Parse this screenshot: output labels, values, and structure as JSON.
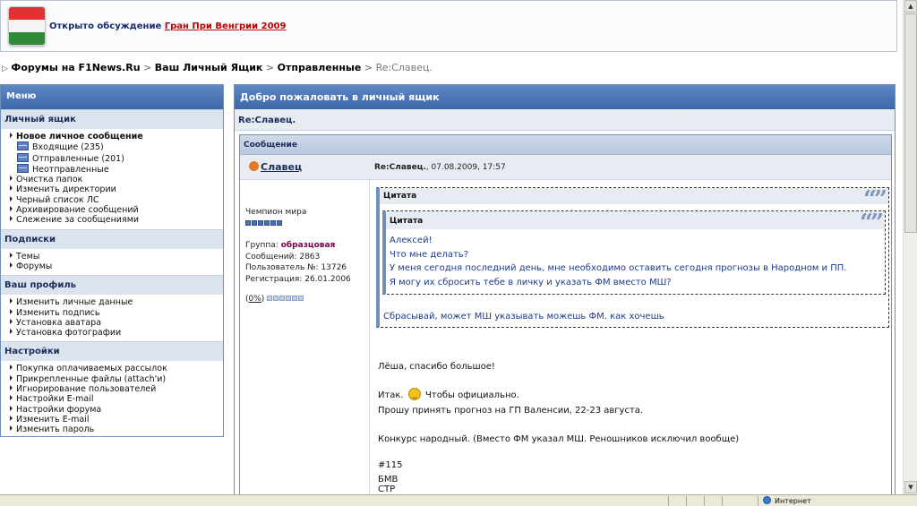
{
  "banner": {
    "text": "Открыто обсуждение",
    "link": "Гран При Венгрии 2009"
  },
  "breadcrumb": {
    "item1": "Форумы на F1News.Ru",
    "item2": "Ваш Личный Ящик",
    "item3": "Отправленные",
    "current": "Re:Славец."
  },
  "menu": {
    "title": "Меню",
    "sections": {
      "mailbox": {
        "title": "Личный ящик",
        "new_message": "Новое личное сообщение",
        "inbox": "Входящие (235)",
        "sent": "Отправленные (201)",
        "unsent": "Неотправленные",
        "clean": "Очистка папок",
        "dirs": "Изменить директории",
        "blacklist": "Черный список ЛС",
        "archive": "Архивирование сообщений",
        "tracking": "Слежение за сообщениями"
      },
      "subscriptions": {
        "title": "Подписки",
        "topics": "Темы",
        "forums": "Форумы"
      },
      "profile": {
        "title": "Ваш профиль",
        "personal": "Изменить личные данные",
        "signature": "Изменить подпись",
        "avatar": "Установка аватара",
        "photo": "Установка фотографии"
      },
      "settings": {
        "title": "Настройки",
        "paid": "Покупка оплачиваемых рассылок",
        "attach": "Прикрепленные файлы (attach'и)",
        "ignore": "Игнорирование пользователей",
        "email_settings": "Настройки E-mail",
        "forum_settings": "Настройки форума",
        "change_email": "Изменить E-mail",
        "change_password": "Изменить пароль"
      }
    }
  },
  "content": {
    "title": "Добро пожаловать в личный ящик",
    "subject": "Re:Славец.",
    "message_header": "Сообщение",
    "author": "Славец",
    "post_title": "Re:Славец.",
    "post_date": ", 07.08.2009, 17:57",
    "user": {
      "rank": "Чемпион мира",
      "rank_level": 6,
      "group_label": "Группа:",
      "group_value": "образцовая",
      "posts": "Сообщений: 2863",
      "user_no": "Пользователь №: 13726",
      "registered": "Регистрация: 26.01.2006",
      "progress": "0%"
    },
    "quote_label_outer": "Цитата",
    "quote_label_inner": "Цитата",
    "inner_quote_lines": [
      "Алексей!",
      "Что мне делать?",
      "У меня сегодня последний день, мне необходимо оставить сегодня прогнозы в Народном и ПП.",
      "Я могу их сбросить тебе в личку и указать ФМ вместо МШ?"
    ],
    "outer_quote_text": "Сбрасывай, может МШ указывать можешь ФМ. как хочешь",
    "post_lines": {
      "l1": "Лёша, спасибо большое!",
      "l2a": "Итак.",
      "l2b": "Чтобы официально.",
      "l3": "Прошу принять прогноз на ГП Валенсии, 22-23 августа.",
      "l4": "Конкурс народный. (Вместо ФМ указал МШ. Реношников исключил вообще)",
      "l5": "#115",
      "l6": "БМВ",
      "l7": "СТР"
    }
  },
  "statusbar": {
    "zone": "Интернет"
  },
  "colors": {
    "header_blue": "#3c67a8",
    "section_bg": "#dbe3ee",
    "quote_text": "#1b3a8a",
    "group_color": "#800050"
  },
  "icons": [
    "flag-hungary-icon",
    "folder-icon",
    "user-icon",
    "quote-marks-icon",
    "smile-icon",
    "globe-icon"
  ]
}
